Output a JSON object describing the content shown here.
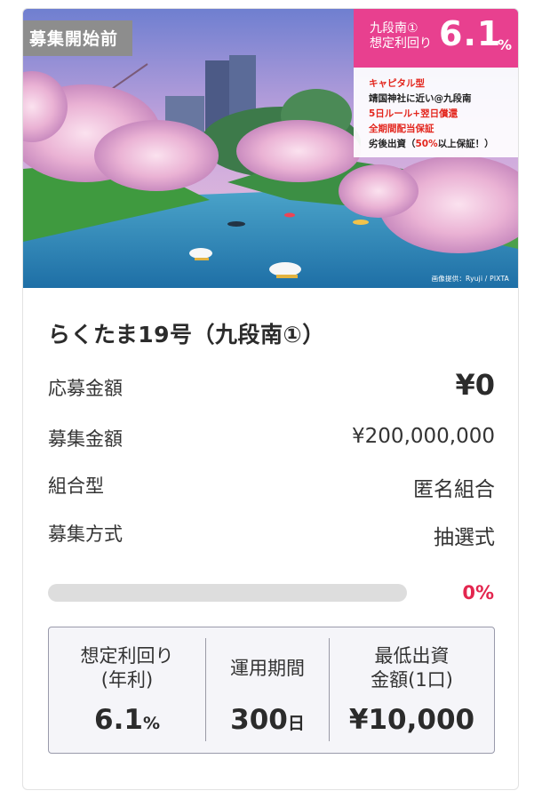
{
  "hero": {
    "status_badge": "募集開始前",
    "yield_flag": {
      "line1": "九段南①",
      "line2": "想定利回り",
      "value": "6.1",
      "unit": "%"
    },
    "features": {
      "f1": "キャピタル型",
      "f2": "靖国神社に近い@九段南",
      "f3": "5日ルール+翌日償還",
      "f4": "全期間配当保証",
      "f5_before": "劣後出資（",
      "f5_pct": "50%",
      "f5_after": "以上保証！）"
    },
    "photo_credit": "画像提供：Ryuji / PIXTA"
  },
  "fund": {
    "title": "らくたま19号（九段南①）",
    "rows": [
      {
        "label": "応募金額",
        "value": "¥0"
      },
      {
        "label": "募集金額",
        "value": "¥200,000,000"
      },
      {
        "label": "組合型",
        "value": "匿名組合"
      },
      {
        "label": "募集方式",
        "value": "抽選式"
      }
    ],
    "progress": {
      "percent": 0,
      "label": "0%"
    }
  },
  "stats": {
    "yield": {
      "label1": "想定利回り",
      "label2": "(年利)",
      "value": "6.1",
      "unit": "%"
    },
    "period": {
      "label1": "運用期間",
      "value": "300",
      "unit": "日"
    },
    "minimum": {
      "label1": "最低出資",
      "label2": "金額(1口)",
      "value": "¥10,000"
    }
  },
  "colors": {
    "accent_pink": "#e8408f",
    "progress_red": "#e3264f",
    "badge_gray": "#8d8d8d"
  }
}
